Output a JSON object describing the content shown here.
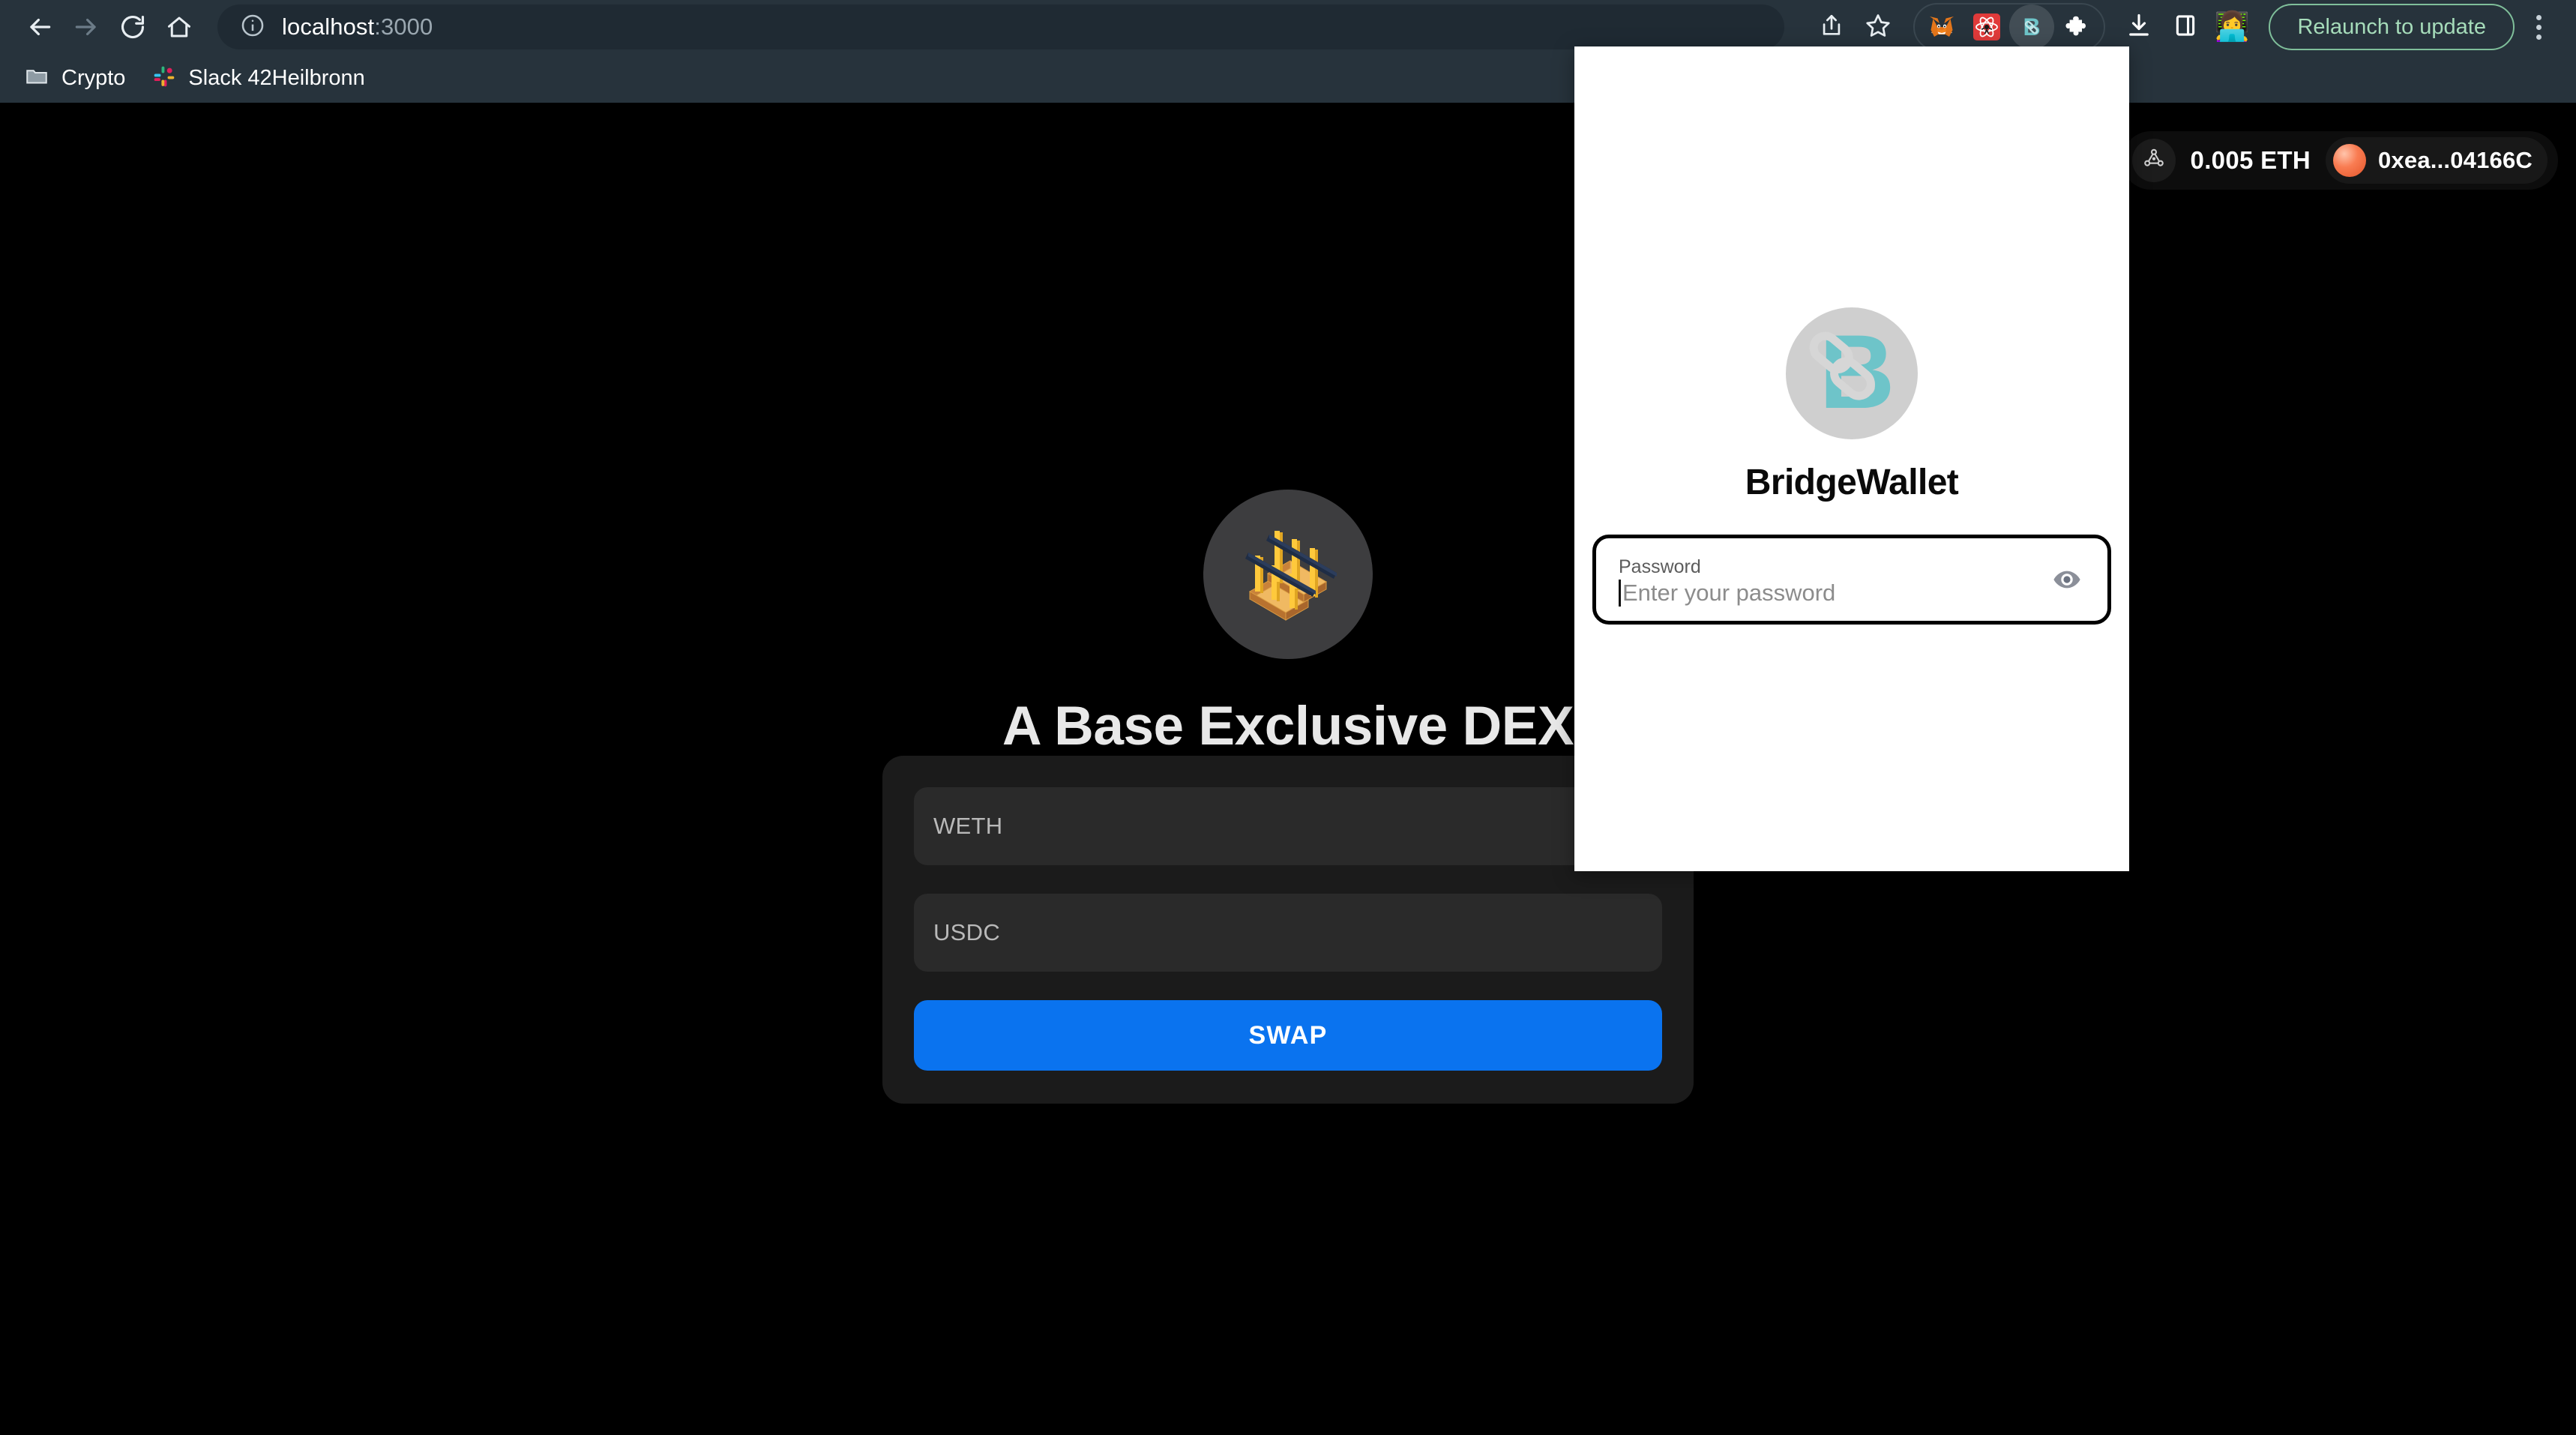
{
  "browser": {
    "nav": {
      "back": "back-arrow",
      "forward": "forward-arrow",
      "reload": "reload",
      "home": "home"
    },
    "url": {
      "host": "localhost",
      "port": ":3000",
      "full": "localhost:3000",
      "info_icon": "site-info-icon"
    },
    "actions": {
      "share_icon": "share-icon",
      "bookmark_icon": "star-icon",
      "downloads_icon": "download-icon",
      "side_panel_icon": "side-panel-icon",
      "profile_icon": "profile-avatar-icon",
      "menu_icon": "three-dot-menu-icon",
      "relaunch_label": "Relaunch to update"
    },
    "extensions": [
      {
        "name": "metamask-extension-icon",
        "glyph": "🦊",
        "active": false
      },
      {
        "name": "react-devtools-extension-icon",
        "glyph": "⚛",
        "active": false
      },
      {
        "name": "bridgewallet-extension-icon",
        "glyph": "B",
        "active": true
      },
      {
        "name": "extensions-puzzle-icon",
        "glyph": "🧩",
        "active": false
      }
    ],
    "bookmarks": [
      {
        "label": "Crypto",
        "icon": "folder-icon"
      },
      {
        "label": "Slack 42Heilbronn",
        "icon": "slack-icon"
      }
    ]
  },
  "dex": {
    "account": {
      "network_icon": "network-nodes-icon",
      "balance": "0.005 ETH",
      "address": "0xea...04166C"
    },
    "hero": {
      "logo_icon": "bridge-illustration-icon",
      "title": "A Base Exclusive DEX"
    },
    "swap": {
      "from_token": "WETH",
      "to_token": "USDC",
      "button_label": "SWAP"
    }
  },
  "wallet_popup": {
    "logo_icon": "bridgewallet-logo-icon",
    "title": "BridgeWallet",
    "password": {
      "label": "Password",
      "placeholder": "Enter your password",
      "value": "",
      "toggle_icon": "eye-icon"
    }
  },
  "colors": {
    "browser_chrome": "#27333c",
    "url_bar": "#1f2a33",
    "page_background": "#000000",
    "card_background": "#1b1b1b",
    "field_background": "#2a2a2a",
    "swap_accent": "#0a73ef",
    "wallet_teal": "#6ec4c9",
    "relaunch_green": "#a6dcba"
  }
}
